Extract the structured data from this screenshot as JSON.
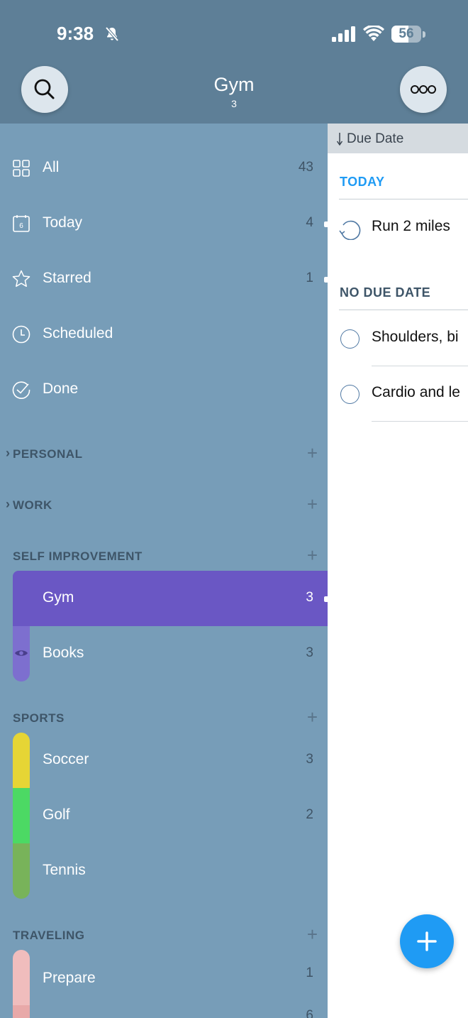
{
  "status_bar": {
    "time": "9:38",
    "battery": "56"
  },
  "header": {
    "title": "Gym",
    "count": "3"
  },
  "smart_lists": [
    {
      "label": "All",
      "count": "43",
      "icon": "grid-icon"
    },
    {
      "label": "Today",
      "count": "4",
      "icon": "calendar-icon"
    },
    {
      "label": "Starred",
      "count": "1",
      "icon": "star-icon"
    },
    {
      "label": "Scheduled",
      "count": "",
      "icon": "clock-icon"
    },
    {
      "label": "Done",
      "count": "",
      "icon": "check-circle-icon"
    }
  ],
  "groups": {
    "personal": {
      "label": "PERSONAL"
    },
    "work": {
      "label": "WORK"
    },
    "self_improvement": {
      "label": "SELF IMPROVEMENT",
      "lists": [
        {
          "label": "Gym",
          "count": "3",
          "color": "#6a57c4"
        },
        {
          "label": "Books",
          "count": "3",
          "color": "#7d6fcf"
        }
      ]
    },
    "sports": {
      "label": "SPORTS",
      "lists": [
        {
          "label": "Soccer",
          "count": "3",
          "color": "#e6d535"
        },
        {
          "label": "Golf",
          "count": "2",
          "color": "#4cd964"
        },
        {
          "label": "Tennis",
          "count": "",
          "color": "#78b35a"
        }
      ]
    },
    "traveling": {
      "label": "TRAVELING",
      "lists": [
        {
          "label": "Prepare",
          "count": "1",
          "color": "#f0bdbd"
        },
        {
          "label": "",
          "count": "6",
          "color": "#e8a9a9"
        }
      ]
    }
  },
  "panel": {
    "sort_label": "Due Date",
    "groups": [
      {
        "label": "TODAY",
        "color": "#1f9bf4",
        "tasks": [
          {
            "title": "Run 2 miles",
            "recurring": true
          }
        ]
      },
      {
        "label": "NO DUE DATE",
        "color": "#3e5568",
        "tasks": [
          {
            "title": "Shoulders, bi"
          },
          {
            "title": "Cardio and le"
          }
        ]
      }
    ]
  },
  "colors": {
    "header": "#5e7f97",
    "sidebar": "#779db8",
    "accent": "#1f9bf4",
    "selected": "#6a57c4"
  }
}
